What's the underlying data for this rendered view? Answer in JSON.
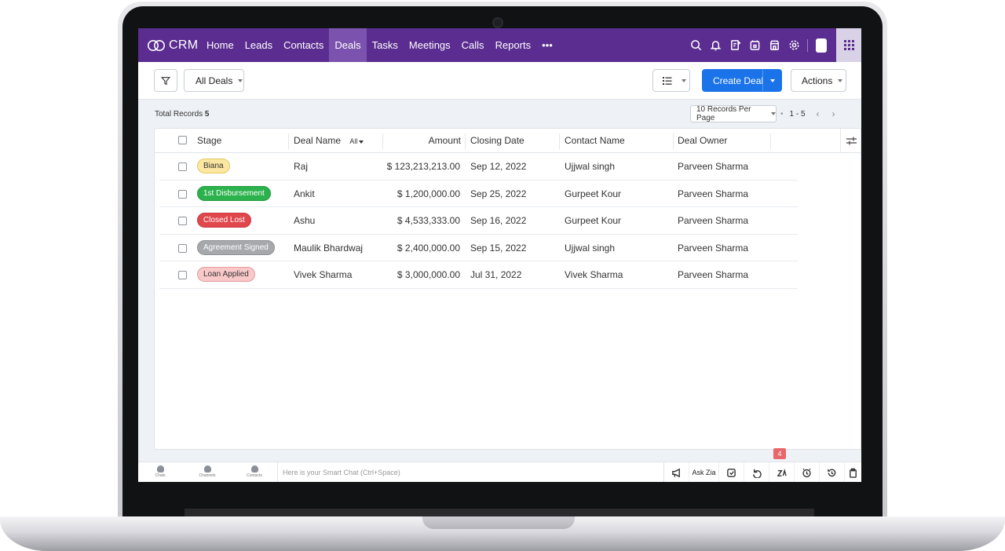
{
  "nav": {
    "brand": "CRM",
    "items": [
      "Home",
      "Leads",
      "Contacts",
      "Deals",
      "Tasks",
      "Meetings",
      "Calls",
      "Reports",
      "•••"
    ],
    "active": "Deals",
    "icons": [
      "search-icon",
      "bell-icon",
      "add-note-icon",
      "calendar-icon",
      "marketplace-icon",
      "settings-icon"
    ]
  },
  "toolbar": {
    "view_label": "All Deals",
    "create_label": "Create Deal",
    "actions_label": "Actions"
  },
  "records": {
    "total_label": "Total Records",
    "total_count": "5",
    "per_page": "10 Records Per Page",
    "range": "1 - 5"
  },
  "table": {
    "headers": {
      "stage": "Stage",
      "deal_name": "Deal Name",
      "deal_filter": "All",
      "amount": "Amount",
      "closing_date": "Closing Date",
      "contact_name": "Contact Name",
      "deal_owner": "Deal Owner"
    },
    "rows": [
      {
        "stage": "Biana",
        "deal_name": "Raj",
        "amount": "$ 123,213,213.00",
        "closing_date": "Sep 12, 2022",
        "contact_name": "Ujjwal singh",
        "deal_owner": "Parveen Sharma"
      },
      {
        "stage": "1st Disbursement",
        "deal_name": "Ankit",
        "amount": "$ 1,200,000.00",
        "closing_date": "Sep 25, 2022",
        "contact_name": "Gurpeet Kour",
        "deal_owner": "Parveen Sharma"
      },
      {
        "stage": "Closed Lost",
        "deal_name": "Ashu",
        "amount": "$ 4,533,333.00",
        "closing_date": "Sep 16, 2022",
        "contact_name": "Gurpeet Kour",
        "deal_owner": "Parveen Sharma"
      },
      {
        "stage": "Agreement Signed",
        "deal_name": "Maulik Bhardwaj",
        "amount": "$ 2,400,000.00",
        "closing_date": "Sep 15, 2022",
        "contact_name": "Ujjwal singh",
        "deal_owner": "Parveen Sharma"
      },
      {
        "stage": "Loan Applied",
        "deal_name": "Vivek Sharma",
        "amount": "$ 3,000,000.00",
        "closing_date": "Jul 31, 2022",
        "contact_name": "Vivek Sharma",
        "deal_owner": "Parveen Sharma"
      }
    ],
    "stage_colors": {
      "Biana": {
        "bg": "#fbe7a1",
        "border": "#e6c95a",
        "text": "#333333"
      },
      "1st Disbursement": {
        "bg": "#2bb24c",
        "border": "#229a40",
        "text": "#ffffff"
      },
      "Closed Lost": {
        "bg": "#e0474c",
        "border": "#c93a3f",
        "text": "#ffffff"
      },
      "Agreement Signed": {
        "bg": "#a6a8ac",
        "border": "#8f9196",
        "text": "#ffffff"
      },
      "Loan Applied": {
        "bg": "#f9c9c9",
        "border": "#e79a9a",
        "text": "#333333"
      }
    }
  },
  "bottombar": {
    "chats": "Chats",
    "channels": "Channels",
    "contacts": "Contacts",
    "smart_chat_placeholder": "Here is your Smart Chat (Ctrl+Space)",
    "ask_zia": "Ask Zia",
    "notif_count": "4"
  },
  "colors": {
    "nav_bg": "#5b2d90",
    "nav_active": "#7b52ad",
    "primary": "#1a73e8"
  }
}
